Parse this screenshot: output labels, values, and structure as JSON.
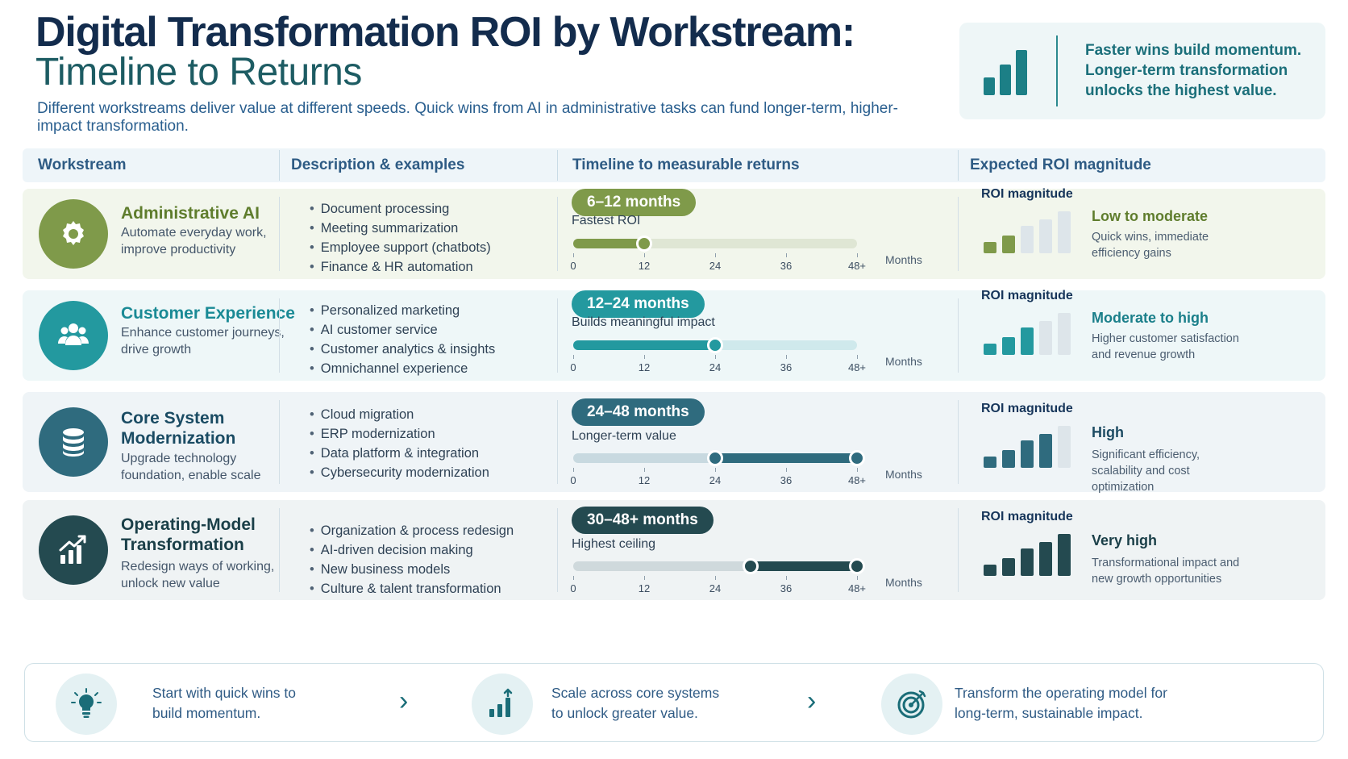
{
  "header": {
    "title": "Digital Transformation ROI by Workstream:",
    "subtitle": "Timeline to Returns",
    "intro": "Different workstreams deliver value at different speeds. Quick wins from AI in administrative tasks can fund longer-term, higher-impact transformation."
  },
  "callout": {
    "text": "Faster wins build momentum. Longer-term transformation unlocks the highest value.",
    "icon": "bar-chart-icon"
  },
  "table": {
    "columns": [
      "Workstream",
      "Description & examples",
      "Timeline to measurable returns",
      "Expected ROI magnitude"
    ],
    "axis_ticks": [
      "0",
      "12",
      "24",
      "36",
      "48+"
    ],
    "axis_unit": "Months",
    "roi_label": "ROI magnitude",
    "rows": [
      {
        "name": "Administrative AI",
        "description": "Automate everyday work, improve productivity",
        "icon": "gear-icon",
        "color": "#7f9a4a",
        "examples": [
          "Document processing",
          "Meeting summarization",
          "Employee support (chatbots)",
          "Finance & HR automation"
        ],
        "timeline": "6–12 months",
        "timeline_label": "Fastest ROI",
        "range_months": [
          0,
          12
        ],
        "roi_level": 2,
        "roi_magnitude": "Low to moderate",
        "roi_description": "Quick wins, immediate efficiency gains"
      },
      {
        "name": "Customer Experience",
        "description": "Enhance customer journeys, drive growth",
        "icon": "users-icon",
        "color": "#23999f",
        "examples": [
          "Personalized marketing",
          "AI customer service",
          "Customer analytics & insights",
          "Omnichannel experience"
        ],
        "timeline": "12–24 months",
        "timeline_label": "Builds meaningful impact",
        "range_months": [
          0,
          24
        ],
        "roi_level": 3,
        "roi_magnitude": "Moderate to high",
        "roi_description": "Higher customer satisfaction and revenue growth"
      },
      {
        "name": "Core System Modernization",
        "description": "Upgrade technology foundation, enable scale",
        "icon": "database-icon",
        "color": "#2f6b7e",
        "examples": [
          "Cloud migration",
          "ERP modernization",
          "Data platform & integration",
          "Cybersecurity modernization"
        ],
        "timeline": "24–48 months",
        "timeline_label": "Longer-term value",
        "range_months": [
          24,
          48
        ],
        "roi_level": 4,
        "roi_magnitude": "High",
        "roi_description": "Significant efficiency, scalability and cost optimization"
      },
      {
        "name": "Operating-Model Transformation",
        "description": "Redesign ways of working, unlock new value",
        "icon": "growth-chart-icon",
        "color": "#244a50",
        "examples": [
          "Organization & process redesign",
          "AI-driven decision making",
          "New business models",
          "Culture & talent transformation"
        ],
        "timeline": "30–48+ months",
        "timeline_label": "Highest ceiling",
        "range_months": [
          30,
          48
        ],
        "roi_level": 5,
        "roi_magnitude": "Very high",
        "roi_description": "Transformational impact and new growth opportunities"
      }
    ]
  },
  "footer": {
    "steps": [
      {
        "text": "Start with quick wins to build momentum.",
        "icon": "lightbulb-icon"
      },
      {
        "text": "Scale across core systems to unlock greater value.",
        "icon": "rising-bars-icon"
      },
      {
        "text": "Transform the operating model for long-term, sustainable impact.",
        "icon": "target-icon"
      }
    ]
  }
}
